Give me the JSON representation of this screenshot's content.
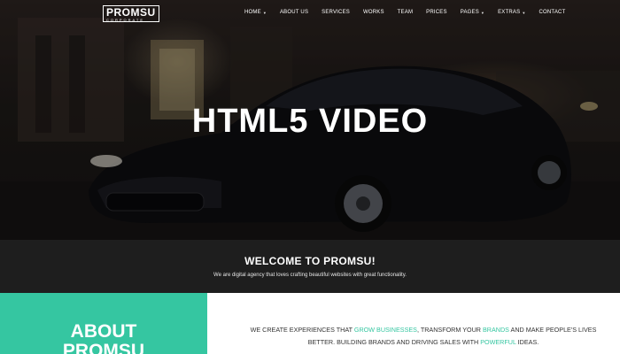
{
  "header": {
    "logo": {
      "main_left": "PROM",
      "main_right": "SU",
      "sub": "CORPORATE"
    },
    "nav": [
      {
        "label": "HOME",
        "dropdown": true
      },
      {
        "label": "ABOUT US",
        "dropdown": false
      },
      {
        "label": "SERVICES",
        "dropdown": false
      },
      {
        "label": "WORKS",
        "dropdown": false
      },
      {
        "label": "TEAM",
        "dropdown": false
      },
      {
        "label": "PRICES",
        "dropdown": false
      },
      {
        "label": "PAGES",
        "dropdown": true
      },
      {
        "label": "EXTRAS",
        "dropdown": true
      },
      {
        "label": "CONTACT",
        "dropdown": false
      }
    ]
  },
  "hero": {
    "title": "HTML5 VIDEO"
  },
  "welcome": {
    "title": "WELCOME TO PROMSU!",
    "subtitle": "We are digital agency that loves crafting beautiful websites with great functionality."
  },
  "about": {
    "heading_line1": "ABOUT",
    "heading_line2": "PROMSU",
    "text": {
      "p1": "WE CREATE EXPERIENCES THAT ",
      "hl1": "GROW BUSINESSES",
      "p2": ", TRANSFORM YOUR ",
      "hl2": "BRANDS",
      "p3": " AND MAKE PEOPLE'S LIVES BETTER. BUILDING BRANDS AND DRIVING SALES WITH ",
      "hl3": "POWERFUL",
      "p4": " IDEAS."
    }
  },
  "colors": {
    "accent": "#35c6a1",
    "welcome_bg": "#1e1e1e"
  },
  "icons": {
    "dropdown": "caret-down-icon"
  }
}
